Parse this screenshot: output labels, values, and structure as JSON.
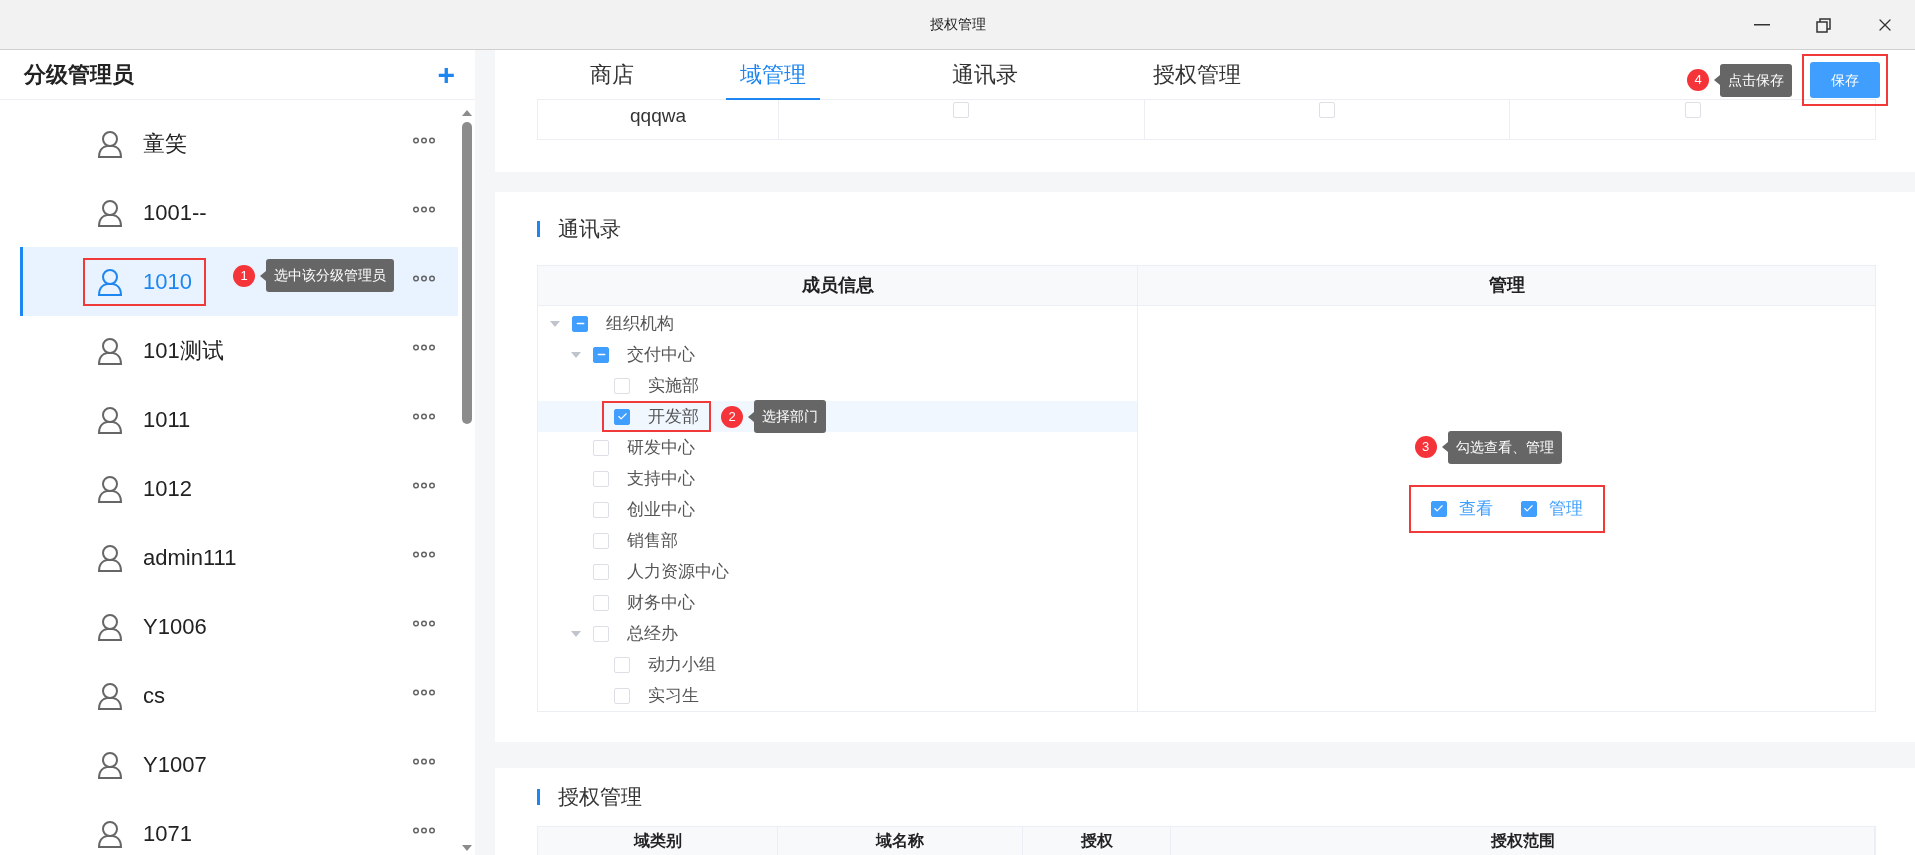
{
  "window": {
    "title": "授权管理"
  },
  "sidebar": {
    "title": "分级管理员",
    "add_button": "+",
    "items": [
      {
        "name": "童笑",
        "selected": false
      },
      {
        "name": "1001--",
        "selected": false
      },
      {
        "name": "1010",
        "selected": true
      },
      {
        "name": "101测试",
        "selected": false
      },
      {
        "name": "1011",
        "selected": false
      },
      {
        "name": "1012",
        "selected": false
      },
      {
        "name": "admin111",
        "selected": false
      },
      {
        "name": "Y1006",
        "selected": false
      },
      {
        "name": "cs",
        "selected": false
      },
      {
        "name": "Y1007",
        "selected": false
      },
      {
        "name": "1071",
        "selected": false
      }
    ]
  },
  "tabs": [
    {
      "label": "商店",
      "selected": false
    },
    {
      "label": "域管理",
      "selected": true
    },
    {
      "label": "通讯录",
      "selected": false
    },
    {
      "label": "授权管理",
      "selected": false
    }
  ],
  "save_button": "保存",
  "domain_table": {
    "rows": [
      {
        "name": "qqqwa",
        "checks": [
          false,
          false,
          false
        ]
      }
    ]
  },
  "contacts": {
    "title": "通讯录",
    "columns": [
      "成员信息",
      "管理"
    ],
    "tree": [
      {
        "label": "组织机构",
        "expanded": true,
        "checked": false,
        "indeterminate": true,
        "selected": false,
        "children": [
          {
            "label": "交付中心",
            "expanded": true,
            "checked": false,
            "indeterminate": true,
            "selected": false,
            "children": [
              {
                "label": "实施部",
                "checked": false,
                "indeterminate": false,
                "selected": false
              },
              {
                "label": "开发部",
                "checked": true,
                "indeterminate": false,
                "selected": true
              }
            ]
          },
          {
            "label": "研发中心",
            "checked": false,
            "indeterminate": false,
            "selected": false
          },
          {
            "label": "支持中心",
            "checked": false,
            "indeterminate": false,
            "selected": false
          },
          {
            "label": "创业中心",
            "checked": false,
            "indeterminate": false,
            "selected": false
          },
          {
            "label": "销售部",
            "checked": false,
            "indeterminate": false,
            "selected": false
          },
          {
            "label": "人力资源中心",
            "checked": false,
            "indeterminate": false,
            "selected": false
          },
          {
            "label": "财务中心",
            "checked": false,
            "indeterminate": false,
            "selected": false
          },
          {
            "label": "总经办",
            "expanded": true,
            "checked": false,
            "indeterminate": false,
            "selected": false,
            "children": [
              {
                "label": "动力小组",
                "checked": false,
                "indeterminate": false,
                "selected": false
              },
              {
                "label": "实习生",
                "checked": false,
                "indeterminate": false,
                "selected": false
              }
            ]
          }
        ]
      }
    ],
    "permissions": [
      {
        "label": "查看",
        "checked": true
      },
      {
        "label": "管理",
        "checked": true
      }
    ]
  },
  "authorization": {
    "title": "授权管理",
    "columns": [
      "域类别",
      "域名称",
      "授权",
      "授权范围"
    ]
  },
  "annotations": [
    {
      "kind": "sidebar_item",
      "number": "1",
      "text": "选中该分级管理员"
    },
    {
      "kind": "tree_node",
      "number": "2",
      "text": "选择部门"
    },
    {
      "kind": "permissions",
      "number": "3",
      "text": "勾选查看、管理"
    },
    {
      "kind": "save_button",
      "number": "4",
      "text": "点击保存"
    }
  ]
}
